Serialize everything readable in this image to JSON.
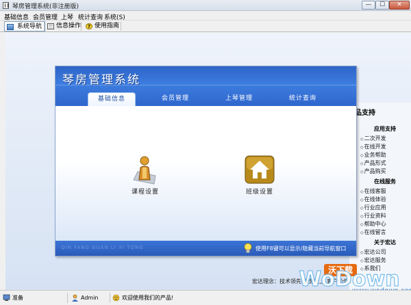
{
  "window": {
    "title": "琴房管理系统(非注册版)",
    "min": "—",
    "max": "☐",
    "close": "✕"
  },
  "menu": [
    "基础信息",
    "会员管理",
    "上琴",
    "统计查询",
    "系统(S)"
  ],
  "toolbar": [
    {
      "label": "系统导航",
      "icon": "nav-icon",
      "active": true
    },
    {
      "label": "信息操作",
      "icon": "info-icon",
      "active": false
    },
    {
      "label": "使用指南",
      "icon": "help-icon",
      "active": false
    }
  ],
  "nav": {
    "title": "琴房管理系统",
    "tabs": [
      "基础信息",
      "会员管理",
      "上琴管理",
      "统计查询"
    ],
    "active_tab": "基础信息",
    "items": [
      {
        "label": "课程设置",
        "icon": "person-icon"
      },
      {
        "label": "班级设置",
        "icon": "house-icon"
      }
    ],
    "footer_brand": "QIN FANG GUAN LI XI TONG",
    "footer_hint": "使用F8键可以显示/隐藏当前导航窗口"
  },
  "support": {
    "title": "品支持",
    "sections": [
      {
        "heading": "应用支持",
        "links": [
          "二次开发",
          "在线开发",
          "业务帮助",
          "产品形式",
          "产品购买"
        ]
      },
      {
        "heading": "在线服务",
        "links": [
          "在线客服",
          "在线体验",
          "行业应用",
          "行业资料",
          "帮助中心",
          "在线留言"
        ]
      },
      {
        "heading": "关于宏达",
        "links": [
          "宏达公司",
          "宏达服务",
          "系我们"
        ]
      }
    ],
    "tagline": "宏达理念：技术领先 服务至上 客户价值！"
  },
  "watermark": {
    "badge": "沃下载",
    "text": "WoDown",
    "url": "www.wodown.com"
  },
  "status": {
    "ready": "准备",
    "user": "Admin",
    "message": "欢迎使用我们的产品!"
  },
  "colors": {
    "header_blue": "#2f66cc",
    "panel_border": "#8ba2c8",
    "gold": "#b88a1c"
  }
}
